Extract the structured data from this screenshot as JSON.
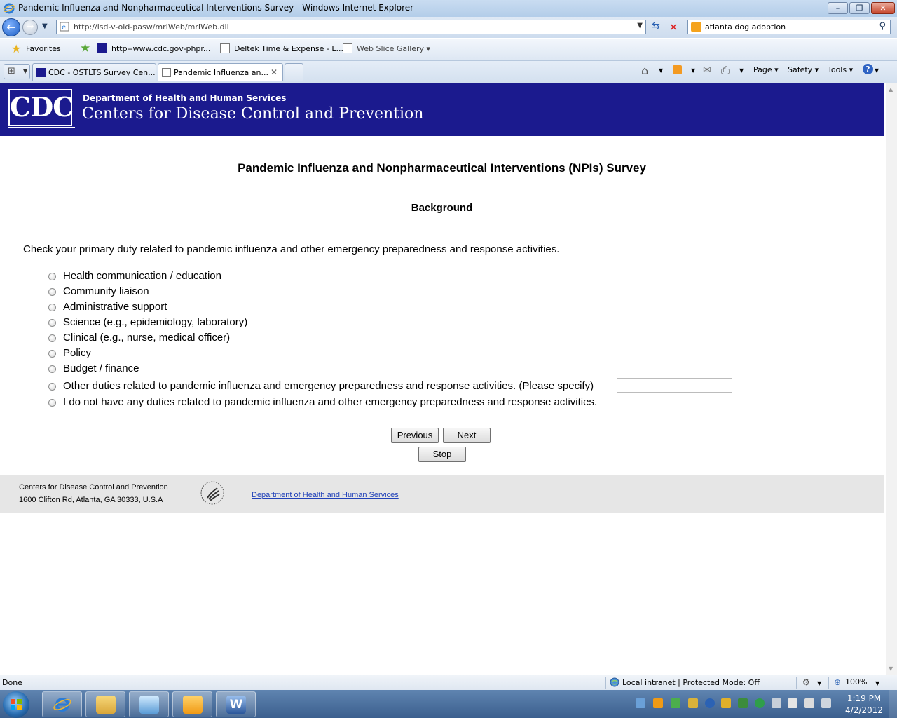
{
  "window": {
    "title": "Pandemic Influenza and Nonpharmaceutical Interventions Survey - Windows Internet Explorer",
    "minimize": "–",
    "maximize": "❒",
    "close": "✕"
  },
  "nav": {
    "url": "http://isd-v-oid-pasw/mrIWeb/mrIWeb.dll",
    "search_query": "atlanta dog adoption"
  },
  "favorites_bar": {
    "favorites_label": "Favorites",
    "items": [
      "http--www.cdc.gov-phpr...",
      "Deltek Time & Expense - L...",
      "Web Slice Gallery ▾"
    ]
  },
  "tabs": [
    {
      "label": "CDC - OSTLTS Survey Cen..."
    },
    {
      "label": "Pandemic Influenza an..."
    }
  ],
  "command_bar": {
    "page": "Page ▾",
    "safety": "Safety ▾",
    "tools": "Tools ▾"
  },
  "banner": {
    "logo_text": "CDC",
    "department": "Department of Health and Human Services",
    "agency": "Centers for Disease Control and Prevention",
    "background": "#1b1a8e"
  },
  "survey": {
    "title": "Pandemic Influenza and Nonpharmaceutical Interventions (NPIs) Survey",
    "section": "Background",
    "question": "Check your primary duty related to pandemic influenza and other emergency preparedness and response activities.",
    "options": [
      "Health communication / education",
      "Community liaison",
      "Administrative support",
      "Science (e.g., epidemiology, laboratory)",
      "Clinical (e.g., nurse, medical officer)",
      "Policy",
      "Budget / finance",
      "Other duties related to pandemic influenza and emergency preparedness and response activities. (Please specify)",
      "I do not have any duties related to pandemic influenza and other emergency preparedness and response activities."
    ],
    "other_value": "",
    "buttons": {
      "previous": "Previous",
      "next": "Next",
      "stop": "Stop"
    }
  },
  "footer": {
    "address_line1": "Centers for Disease Control and Prevention",
    "address_line2": "1600 Clifton Rd, Atlanta, GA 30333, U.S.A",
    "hhs_link": "Department of Health and Human Services"
  },
  "status_bar": {
    "status": "Done",
    "zone": "Local intranet | Protected Mode: Off",
    "zoom": "100%"
  },
  "taskbar": {
    "time": "1:19 PM",
    "date": "4/2/2012"
  }
}
